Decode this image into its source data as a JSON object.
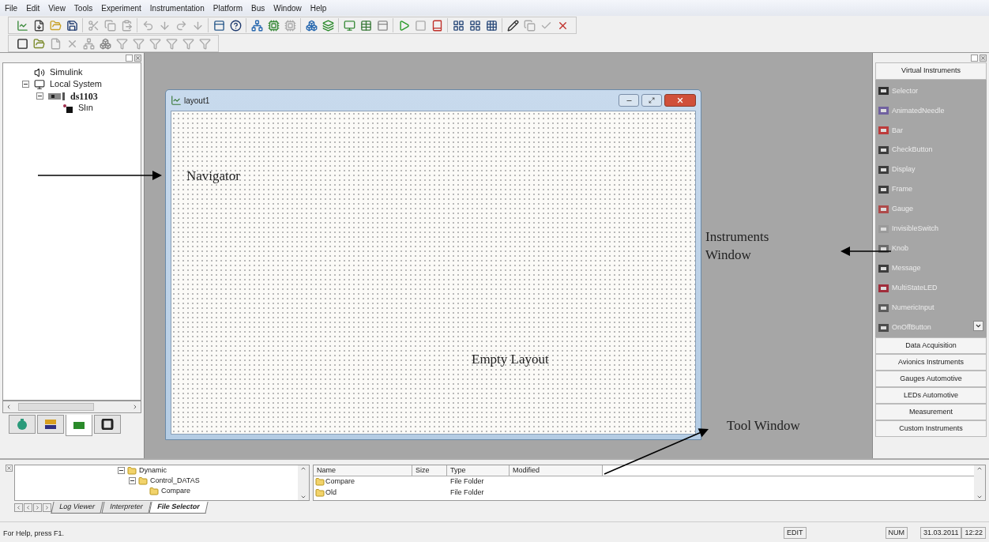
{
  "menu": [
    "File",
    "Edit",
    "View",
    "Tools",
    "Experiment",
    "Instrumentation",
    "Platform",
    "Bus",
    "Window",
    "Help"
  ],
  "navigator": {
    "tree": [
      {
        "label": "Simulink",
        "kind": "simulink",
        "bold": false
      },
      {
        "label": "Local System",
        "kind": "system",
        "bold": false,
        "expanded": true,
        "children": [
          {
            "label": "ds1103",
            "kind": "board",
            "bold": true,
            "expanded": true,
            "children": [
              {
                "label": "Slın",
                "kind": "application",
                "bold": false
              }
            ]
          }
        ]
      }
    ],
    "tabs": [
      {
        "selected": false
      },
      {
        "selected": false
      },
      {
        "selected": true
      },
      {
        "selected": false
      }
    ]
  },
  "layout_window": {
    "title": "layout1"
  },
  "instruments": {
    "header": "Virtual Instruments",
    "items": [
      "Selector",
      "AnimatedNeedle",
      "Bar",
      "CheckButton",
      "Display",
      "Frame",
      "Gauge",
      "InvisibleSwitch",
      "Knob",
      "Message",
      "MultiStateLED",
      "NumericInput",
      "OnOffButton"
    ],
    "groups": [
      "Data Acquisition",
      "Avionics Instruments",
      "Gauges Automotive",
      "LEDs Automotive",
      "Measurement",
      "Custom Instruments"
    ]
  },
  "tool_window": {
    "tree": [
      {
        "label": "Dynamic",
        "expanded": true,
        "children": [
          {
            "label": "Control_DATAS",
            "expanded": true,
            "children": [
              {
                "label": "Compare"
              }
            ]
          }
        ]
      }
    ],
    "columns": [
      "Name",
      "Size",
      "Type",
      "Modified"
    ],
    "rows": [
      {
        "name": "Compare",
        "type": "File Folder"
      },
      {
        "name": "Old",
        "type": "File Folder"
      }
    ],
    "tabs": [
      {
        "label": "Log Viewer",
        "selected": false
      },
      {
        "label": "Interpreter",
        "selected": false
      },
      {
        "label": "File Selector",
        "selected": true
      }
    ]
  },
  "status_bar": {
    "help": "For Help, press F1.",
    "panes": [
      "EDIT",
      "NUM",
      "31.03.2011",
      "12:22"
    ]
  },
  "annotations": [
    {
      "kind": "navigator",
      "text": "Navigator"
    },
    {
      "kind": "instruments",
      "text": "Instruments Window"
    },
    {
      "kind": "layout",
      "text": "Empty Layout"
    },
    {
      "kind": "tool",
      "text": "Tool Window"
    }
  ]
}
